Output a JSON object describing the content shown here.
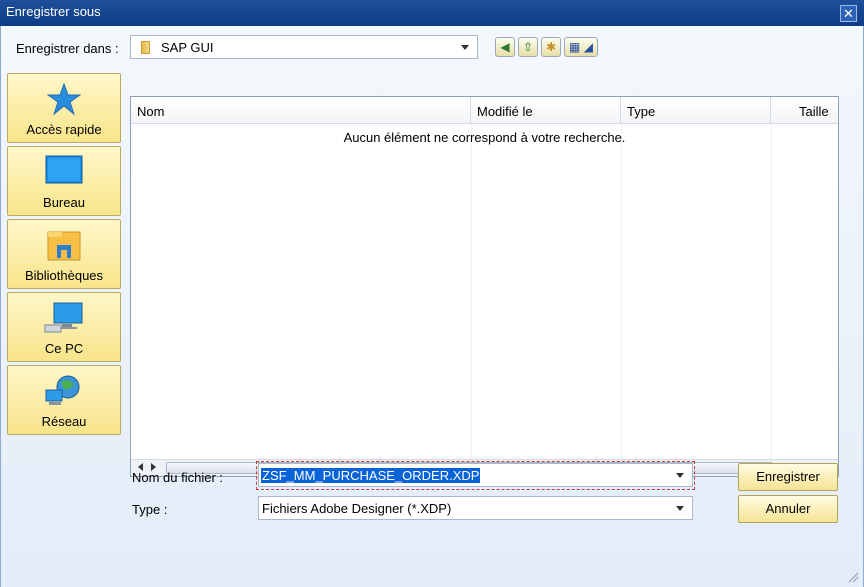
{
  "window": {
    "title": "Enregistrer sous"
  },
  "save_in": {
    "label": "Enregistrer dans :",
    "value": "SAP GUI"
  },
  "toolbar": {
    "back_icon": "back-icon",
    "up_icon": "up-folder-icon",
    "new_folder_icon": "new-folder-icon",
    "view_icon": "view-menu-icon"
  },
  "places": [
    {
      "label": "Accès rapide",
      "icon": "star-icon"
    },
    {
      "label": "Bureau",
      "icon": "desktop-icon"
    },
    {
      "label": "Bibliothèques",
      "icon": "library-icon"
    },
    {
      "label": "Ce PC",
      "icon": "computer-icon"
    },
    {
      "label": "Réseau",
      "icon": "network-icon"
    }
  ],
  "columns": [
    "Nom",
    "Modifié le",
    "Type",
    "Taille"
  ],
  "empty_message": "Aucun élément ne correspond à votre recherche.",
  "filename": {
    "label": "Nom du fichier :",
    "value": "ZSF_MM_PURCHASE_ORDER.XDP"
  },
  "filetype": {
    "label": "Type :",
    "value": "Fichiers Adobe Designer (*.XDP)"
  },
  "buttons": {
    "save": "Enregistrer",
    "cancel": "Annuler"
  },
  "colors": {
    "title_bar": "#0f3d86",
    "button_fill": "#f5e495",
    "selection": "#0a64d8"
  }
}
